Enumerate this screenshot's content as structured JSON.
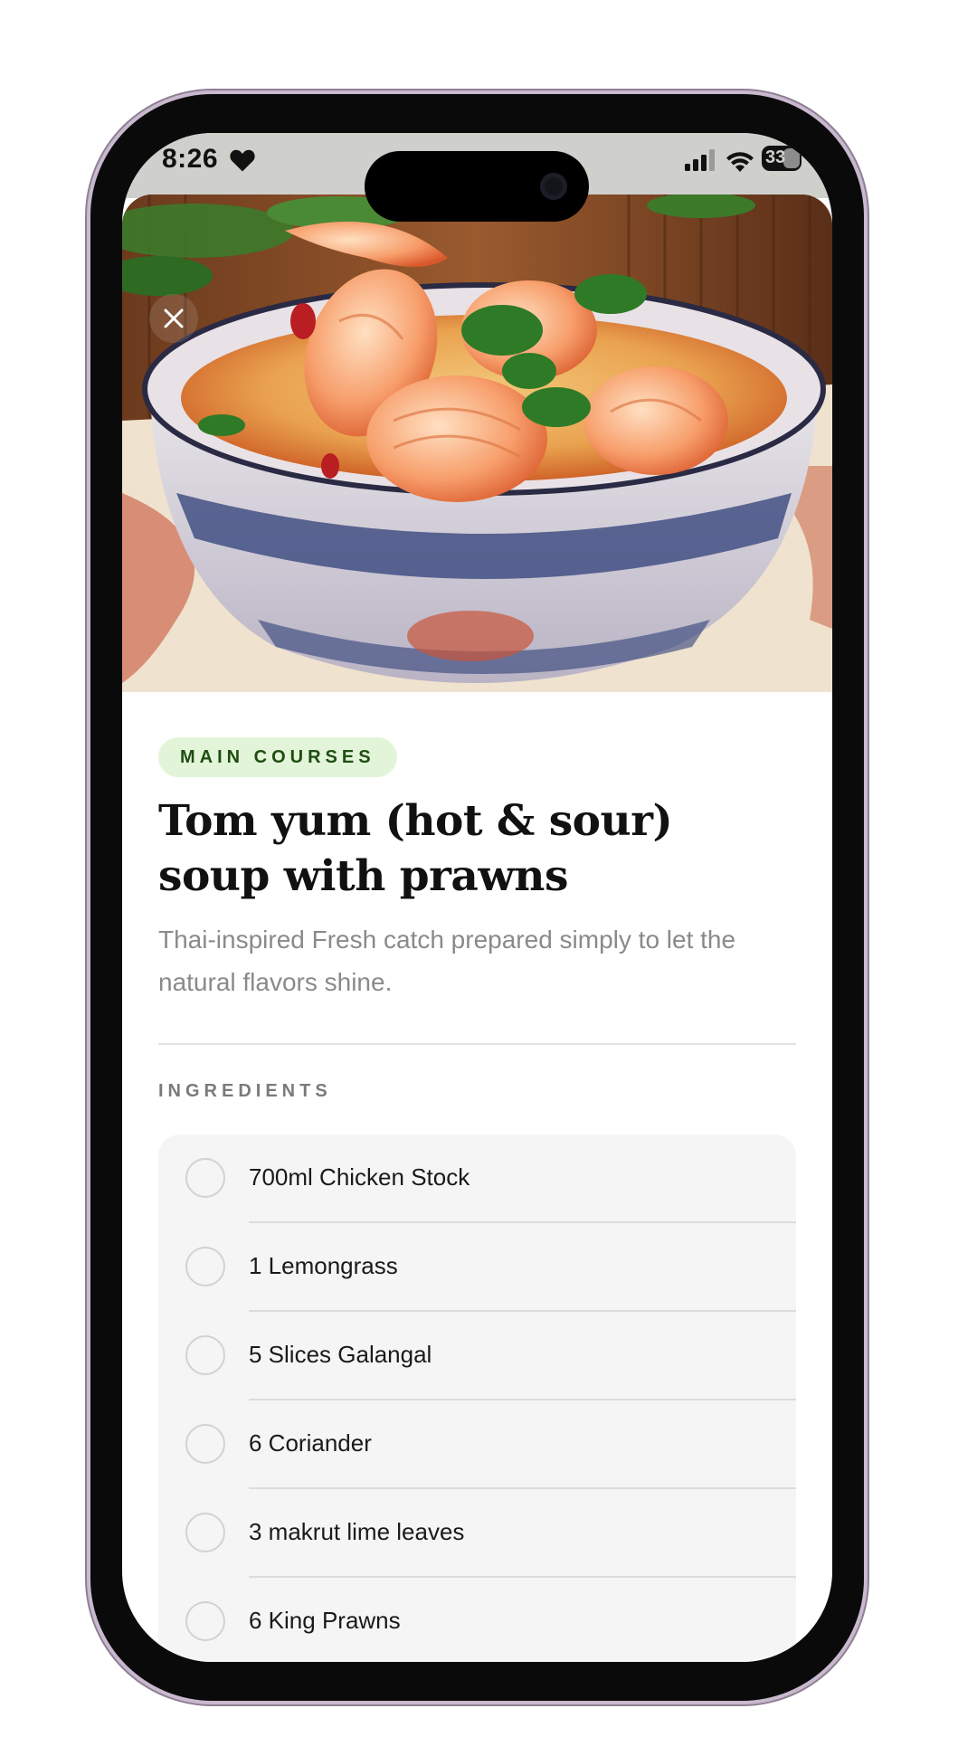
{
  "status_bar": {
    "time": "8:26",
    "battery": "33"
  },
  "hero": {
    "image": "tom-yum-soup-photo"
  },
  "recipe": {
    "category": "MAIN COURSES",
    "title": "Tom yum (hot & sour) soup with prawns",
    "description": "Thai-inspired Fresh catch prepared simply to let the natural flavors shine."
  },
  "ingredients": {
    "heading": "INGREDIENTS",
    "items": [
      "700ml Chicken Stock",
      "1 Lemongrass",
      "5 Slices Galangal",
      "6 Coriander",
      "3 makrut lime leaves",
      "6 King Prawns"
    ]
  },
  "colors": {
    "badge_bg": "#e3f5d8",
    "badge_text": "#1f4d12",
    "card_bg": "#f5f5f5"
  }
}
